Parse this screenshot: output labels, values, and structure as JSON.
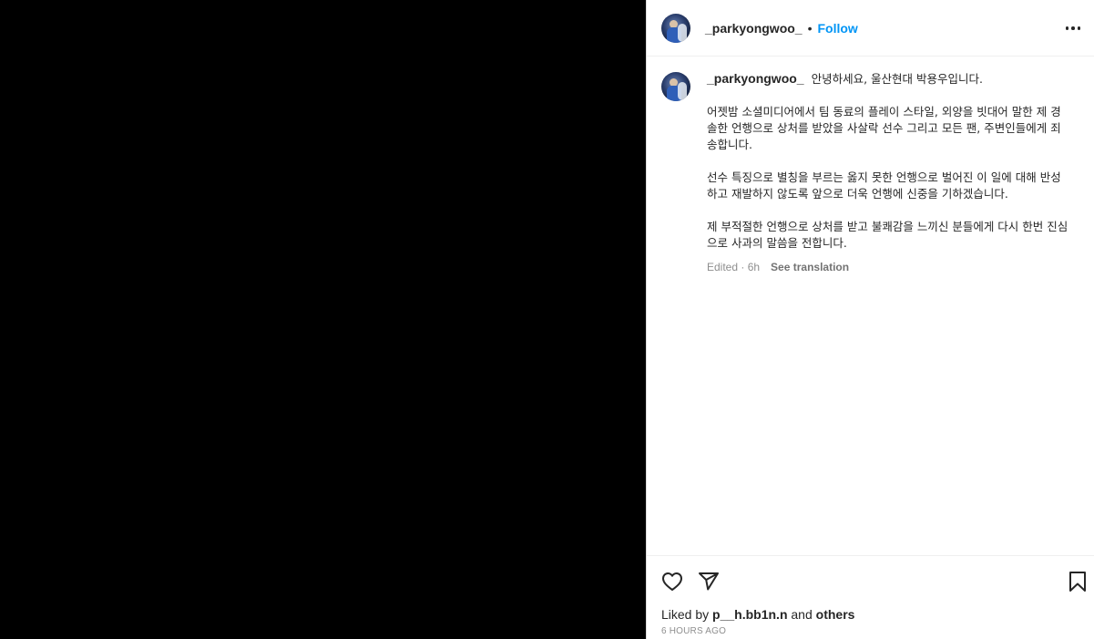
{
  "post": {
    "author": "_parkyongwoo_",
    "dot": "•",
    "follow_label": "Follow",
    "caption": {
      "username": "_parkyongwoo_",
      "line1": "안녕하세요, 울산현대 박용우입니다.",
      "paragraphs": [
        "어젯밤 소셜미디어에서 팀 동료의 플레이 스타일, 외양을 빗대어 말한 제 경솔한 언행으로 상처를 받았을 사살락 선수 그리고 모든 팬, 주변인들에게 죄송합니다.",
        "선수 특징으로 별칭을 부르는 옳지 못한 언행으로 벌어진 이 일에 대해 반성하고 재발하지 않도록 앞으로 더욱 언행에 신중을 기하겠습니다.",
        "제 부적절한 언행으로 상처를 받고 불쾌감을 느끼신 분들에게 다시 한번 진심으로 사과의 말씀을 전합니다."
      ],
      "edited": "Edited · 6h",
      "see_translation": "See translation"
    },
    "likes": {
      "prefix": "Liked by",
      "user": "p__h.bb1n.n",
      "and": "and",
      "others": "others"
    },
    "timestamp": "6 HOURS AGO"
  },
  "icons": {
    "like": "heart-icon",
    "share": "paper-plane-icon",
    "save": "bookmark-icon",
    "more": "more-options-icon"
  },
  "colors": {
    "accent": "#0095f6",
    "text": "#262626",
    "muted": "#8e8e8e",
    "media_bg": "#000000"
  }
}
